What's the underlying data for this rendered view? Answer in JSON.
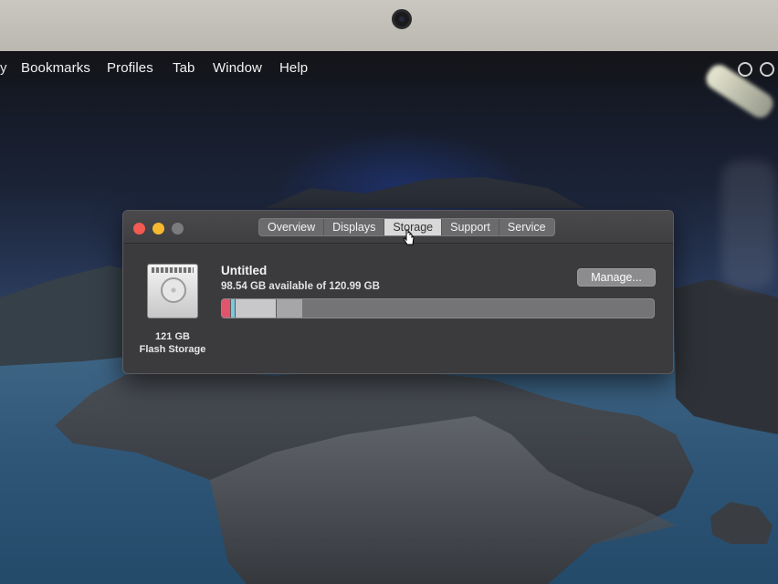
{
  "menubar": {
    "items": [
      "Bookmarks",
      "Profiles",
      "Tab",
      "Window",
      "Help"
    ],
    "leading_fragment": "y"
  },
  "window": {
    "tabs": [
      {
        "label": "Overview",
        "active": false
      },
      {
        "label": "Displays",
        "active": false
      },
      {
        "label": "Storage",
        "active": true
      },
      {
        "label": "Support",
        "active": false
      },
      {
        "label": "Service",
        "active": false
      }
    ],
    "disk": {
      "capacity_label": "121 GB",
      "type_label": "Flash Storage"
    },
    "volume": {
      "name": "Untitled",
      "availability": "98.54 GB available of 120.99 GB",
      "manage_label": "Manage..."
    },
    "storage_bar": {
      "used_fraction": 0.1855,
      "segments": [
        {
          "category": "red",
          "fraction": 0.018,
          "color": "#e0556c"
        },
        {
          "category": "cyan",
          "fraction": 0.012,
          "color": "#7ec8d8"
        },
        {
          "category": "light-gray",
          "fraction": 0.094,
          "color": "#c8c7ca"
        },
        {
          "category": "gray",
          "fraction": 0.062,
          "color": "#a6a5a8"
        }
      ]
    }
  },
  "colors": {
    "traffic_close": "#f25a52",
    "traffic_minimize": "#f5b82e",
    "traffic_zoom": "#7b7a7d"
  }
}
